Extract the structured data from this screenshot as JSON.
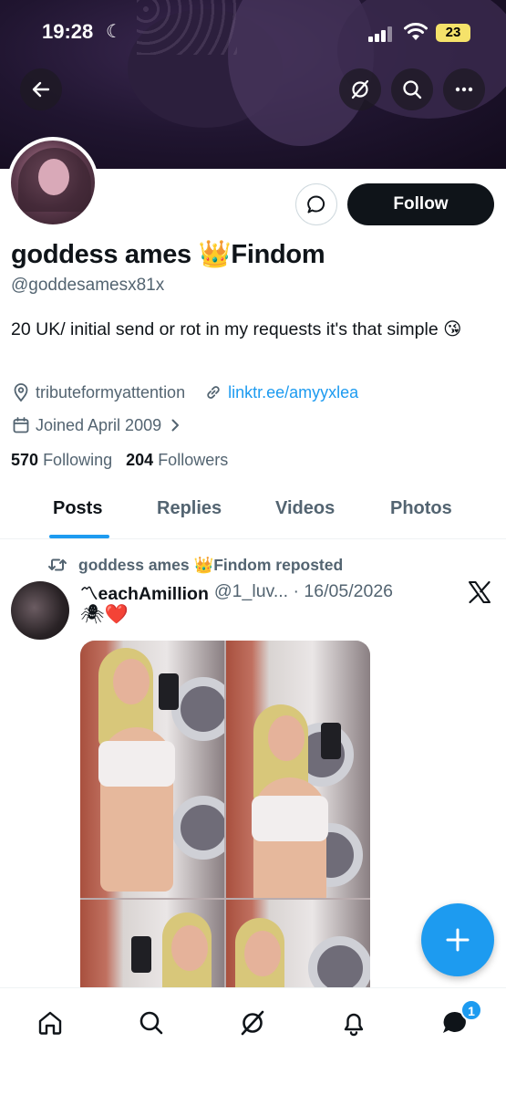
{
  "status_bar": {
    "time": "19:28",
    "battery": "23"
  },
  "profile": {
    "display_name": "goddess ames 👑Findom",
    "handle": "@goddesamesx81x",
    "bio": "20 UK/ initial send or rot in my requests it's that simple 😘",
    "location": "tributeformyattention",
    "website": "linktr.ee/amyyxlea",
    "joined": "Joined April 2009",
    "following_count": "570",
    "following_label": "Following",
    "followers_count": "204",
    "followers_label": "Followers",
    "follow_label": "Follow"
  },
  "tabs": [
    {
      "label": "Posts",
      "active": true
    },
    {
      "label": "Replies",
      "active": false
    },
    {
      "label": "Videos",
      "active": false
    },
    {
      "label": "Photos",
      "active": false
    }
  ],
  "post": {
    "repost_label": "goddess ames 👑Findom reposted",
    "author_name": "〽eachAmillion",
    "author_meta": "@1_luv... · 16/05/2026",
    "text": "🕷❤️"
  },
  "notifications": {
    "messages_badge": "1"
  },
  "colors": {
    "accent": "#1d9bf0",
    "text": "#0f1419",
    "muted": "#536471"
  },
  "icons": [
    "back-arrow-icon",
    "grok-icon",
    "search-icon",
    "more-icon",
    "message-icon",
    "location-icon",
    "link-icon",
    "calendar-icon",
    "chevron-right-icon",
    "repost-icon",
    "x-logo-icon",
    "plus-icon",
    "home-icon",
    "bell-icon",
    "envelope-icon"
  ]
}
